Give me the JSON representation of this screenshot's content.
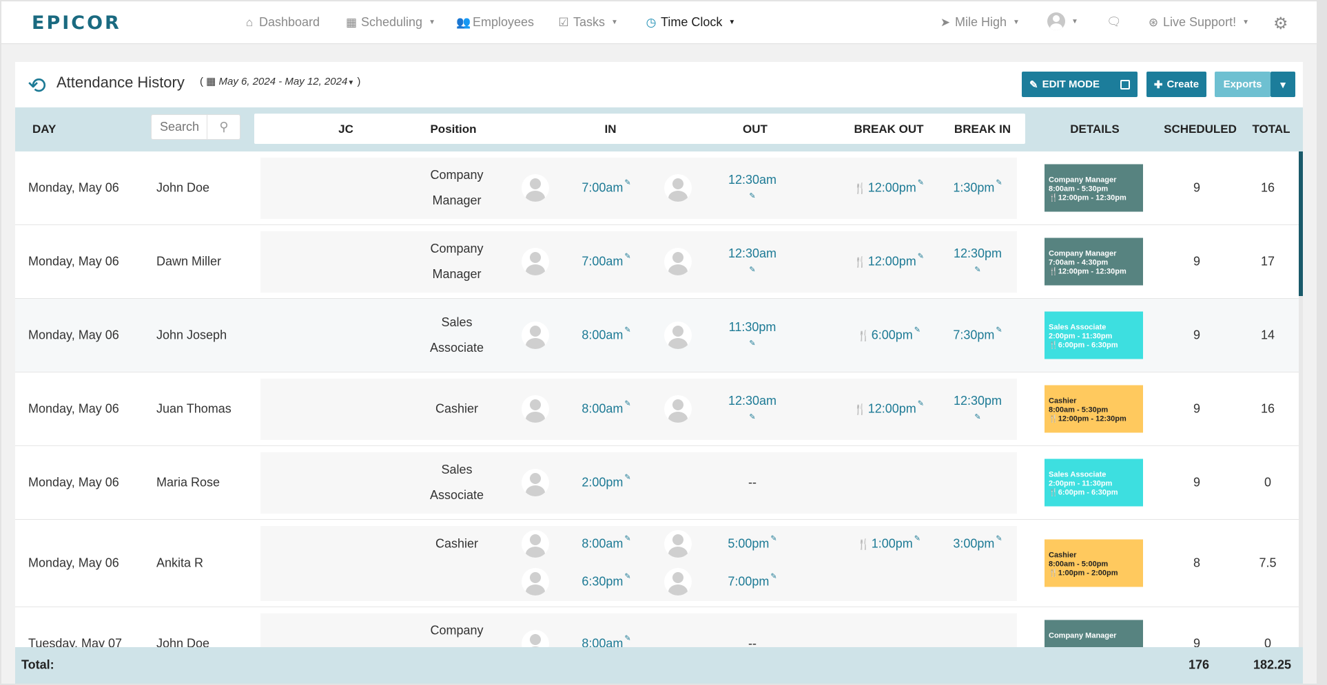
{
  "nav": {
    "logo": "EPICOR",
    "dashboard": "Dashboard",
    "scheduling": "Scheduling",
    "employees": "Employees",
    "tasks": "Tasks",
    "time_clock": "Time Clock",
    "location": "Mile High",
    "live_support": "Live Support!"
  },
  "panel": {
    "title": "Attendance History",
    "date_range": "May 6, 2024 - May 12, 2024",
    "edit_mode": "EDIT MODE",
    "create": "Create",
    "exports": "Exports"
  },
  "table": {
    "headers": {
      "day": "DAY",
      "jc": "JC",
      "position": "Position",
      "in": "IN",
      "out": "OUT",
      "break_out": "BREAK OUT",
      "break_in": "BREAK IN",
      "details": "DETAILS",
      "scheduled": "SCHEDULED",
      "total": "TOTAL"
    },
    "search_placeholder": "Search",
    "rows": [
      {
        "day": "Monday, May 06",
        "name": "John Doe",
        "position": "Company Manager",
        "in": "7:00am",
        "out": "12:30am",
        "break_out": "12:00pm",
        "break_in": "1:30pm",
        "in2": "",
        "out2": "",
        "detail_l1": "Company Manager",
        "detail_l2": "8:00am - 5:30pm",
        "detail_l3": "12:00pm - 12:30pm",
        "scheduled": "9",
        "total": "16"
      },
      {
        "day": "Monday, May 06",
        "name": "Dawn Miller",
        "position": "Company Manager",
        "in": "7:00am",
        "out": "12:30am",
        "break_out": "12:00pm",
        "break_in": "12:30pm",
        "in2": "",
        "out2": "",
        "detail_l1": "Company Manager",
        "detail_l2": "7:00am - 4:30pm",
        "detail_l3": "12:00pm - 12:30pm",
        "scheduled": "9",
        "total": "17"
      },
      {
        "day": "Monday, May 06",
        "name": "John Joseph",
        "position": "Sales Associate",
        "in": "8:00am",
        "out": "11:30pm",
        "break_out": "6:00pm",
        "break_in": "7:30pm",
        "in2": "",
        "out2": "",
        "detail_l1": "Sales Associate",
        "detail_l2": "2:00pm - 11:30pm",
        "detail_l3": "6:00pm - 6:30pm",
        "scheduled": "9",
        "total": "14"
      },
      {
        "day": "Monday, May 06",
        "name": "Juan Thomas",
        "position": "Cashier",
        "in": "8:00am",
        "out": "12:30am",
        "break_out": "12:00pm",
        "break_in": "12:30pm",
        "in2": "",
        "out2": "",
        "detail_l1": "Cashier",
        "detail_l2": "8:00am - 5:30pm",
        "detail_l3": "12:00pm - 12:30pm",
        "scheduled": "9",
        "total": "16"
      },
      {
        "day": "Monday, May 06",
        "name": "Maria Rose",
        "position": "Sales Associate",
        "in": "2:00pm",
        "out": "--",
        "break_out": "",
        "break_in": "",
        "in2": "",
        "out2": "",
        "detail_l1": "Sales Associate",
        "detail_l2": "2:00pm - 11:30pm",
        "detail_l3": "6:00pm - 6:30pm",
        "scheduled": "9",
        "total": "0"
      },
      {
        "day": "Monday, May 06",
        "name": "Ankita R",
        "position": "Cashier",
        "in": "8:00am",
        "out": "5:00pm",
        "break_out": "1:00pm",
        "break_in": "3:00pm",
        "in2": "6:30pm",
        "out2": "7:00pm",
        "detail_l1": "Cashier",
        "detail_l2": "8:00am - 5:00pm",
        "detail_l3": "1:00pm - 2:00pm",
        "scheduled": "8",
        "total": "7.5"
      },
      {
        "day": "Tuesday, May 07",
        "name": "John Doe",
        "position": "Company",
        "in": "8:00am",
        "out": "--",
        "break_out": "",
        "break_in": "",
        "in2": "",
        "out2": "",
        "detail_l1": "Company Manager",
        "detail_l2": "",
        "detail_l3": "",
        "scheduled": "9",
        "total": "0"
      }
    ]
  },
  "footer": {
    "label": "Total:",
    "scheduled": "176",
    "total": "182.25"
  }
}
